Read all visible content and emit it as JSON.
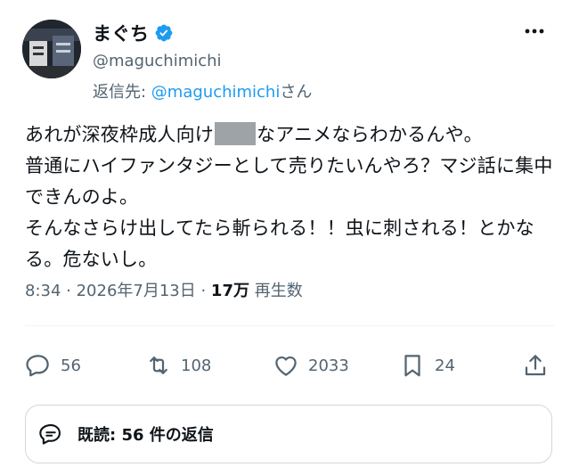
{
  "author": {
    "display_name": "まぐち",
    "handle": "@maguchimichi"
  },
  "reply": {
    "prefix": "返信先: ",
    "handle": "@maguchimichi",
    "suffix": "さん"
  },
  "tweet": {
    "text_part1": "あれが深夜枠成人向け",
    "text_part2": "なアニメならわかるんや。\n普通にハイファンタジーとして売りたいんやろ？マジ話に集中できんのよ。\nそんなさらけ出してたら斬られる！！虫に刺される！とかなる。危ないし。"
  },
  "meta": {
    "time_date": "8:34 · 2026年7月13日 · ",
    "views_count": "17万",
    "views_label": " 再生数"
  },
  "actions": {
    "replies": "56",
    "retweets": "108",
    "likes": "2033",
    "bookmarks": "24"
  },
  "read_replies": "既読: 56 件の返信",
  "colors": {
    "link": "#1d9bf0",
    "secondary_text": "#536471",
    "border": "#cfd9de"
  }
}
